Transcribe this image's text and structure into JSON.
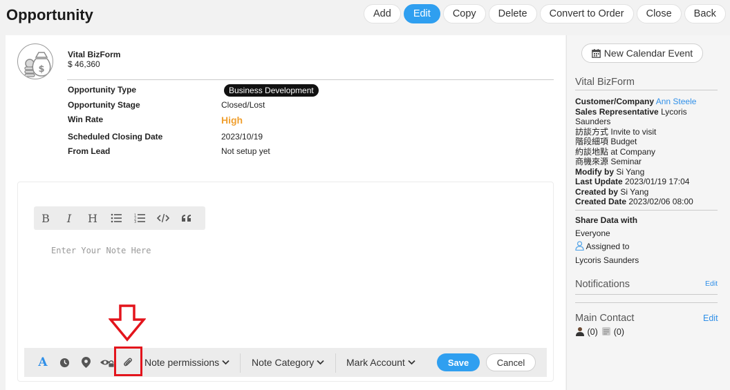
{
  "page": {
    "title": "Opportunity"
  },
  "toolbar": {
    "add": "Add",
    "edit": "Edit",
    "copy": "Copy",
    "delete": "Delete",
    "convert": "Convert to Order",
    "close": "Close",
    "back": "Back"
  },
  "record": {
    "company": "Vital BizForm",
    "amount": "$ 46,360"
  },
  "fields": [
    {
      "label": "Opportunity Type",
      "value": "Business Development"
    },
    {
      "label": "Opportunity Stage",
      "value": "Closed/Lost"
    },
    {
      "label": "Win Rate",
      "value": "High"
    },
    {
      "label": "Scheduled Closing Date",
      "value": "2023/10/19"
    },
    {
      "label": "From Lead",
      "value": "Not setup yet"
    }
  ],
  "note": {
    "placeholder": "Enter Your Note Here",
    "permissions": "Note permissions",
    "category": "Note Category",
    "mark_account": "Mark Account",
    "save": "Save",
    "cancel": "Cancel"
  },
  "side": {
    "calendar_button": "New Calendar Event",
    "company": "Vital BizForm",
    "details": {
      "customer_label": "Customer/Company",
      "customer_value": "Ann Steele",
      "rep_label": "Sales Representative",
      "rep_value": "Lycoris Saunders",
      "visit_label": "訪談方式",
      "visit_value": "Invite to visit",
      "stage_label": "階段細項",
      "stage_value": "Budget",
      "place_label": "約談地點",
      "place_value": "at Company",
      "source_label": "商機來源",
      "source_value": "Seminar",
      "modify_label": "Modify by",
      "modify_value": "Si Yang",
      "update_label": "Last Update",
      "update_value": "2023/01/19 17:04",
      "created_by_label": "Created by",
      "created_by_value": "Si Yang",
      "created_date_label": "Created Date",
      "created_date_value": "2023/02/06 08:00"
    },
    "share_heading": "Share Data with",
    "share_everyone": "Everyone",
    "assigned_to": "Assigned to",
    "assigned_name": "Lycoris Saunders",
    "notifications": "Notifications",
    "notifications_edit": "Edit",
    "main_contact": "Main Contact",
    "main_contact_edit": "Edit",
    "contact_count_person": "(0)",
    "contact_count_card": "(0)"
  },
  "colors": {
    "accent": "#2f9ff0",
    "highlight": "#e3141c",
    "win_rate": "#f0a030"
  },
  "icons": [
    "money-bag-icon",
    "bold-icon",
    "italic-icon",
    "heading-icon",
    "bullet-list-icon",
    "numbered-list-icon",
    "code-icon",
    "quote-icon",
    "text-color-icon",
    "clock-icon",
    "location-pin-icon",
    "eye-lock-icon",
    "paperclip-icon",
    "chevron-down-icon",
    "calendar-icon",
    "user-icon",
    "contact-card-icon",
    "arrow-down-icon"
  ]
}
